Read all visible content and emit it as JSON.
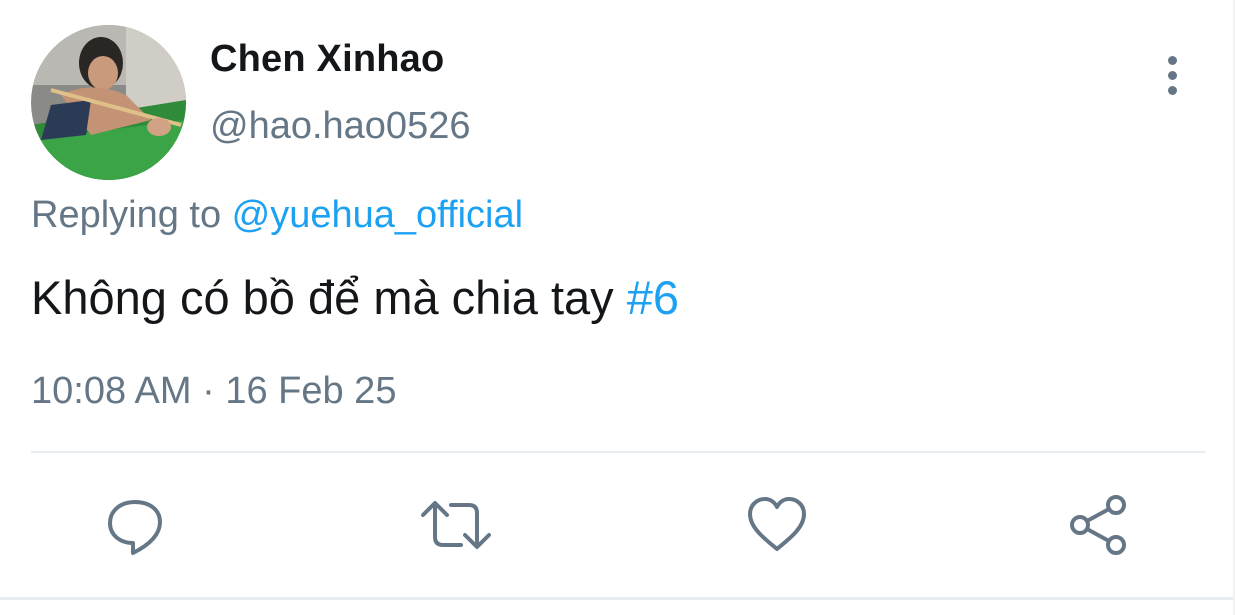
{
  "user": {
    "display_name": "Chen Xinhao",
    "handle": "@hao.hao0526"
  },
  "reply": {
    "prefix": "Replying to ",
    "mention": "@yuehua_official"
  },
  "tweet": {
    "text": "Không có bồ để mà chia tay ",
    "hashtag": "#6",
    "timestamp": "10:08 AM · 16 Feb 25"
  },
  "actions": {
    "icons": [
      "reply-icon",
      "retweet-icon",
      "like-icon",
      "share-icon"
    ]
  },
  "colors": {
    "primary_text": "#14171a",
    "secondary_text": "#657786",
    "accent": "#1da1f2",
    "divider": "#e6ecf0"
  }
}
